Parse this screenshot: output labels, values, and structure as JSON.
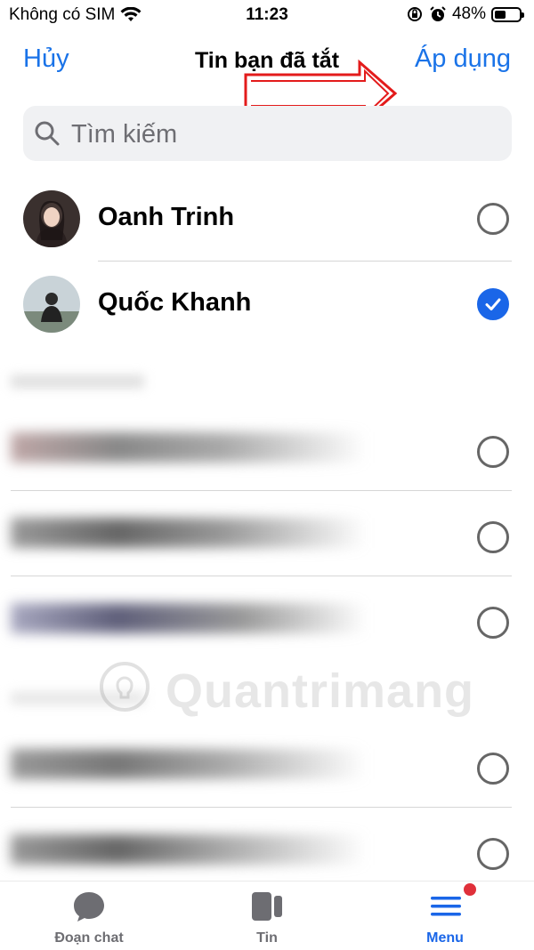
{
  "status_bar": {
    "carrier": "Không có SIM",
    "time": "11:23",
    "battery": "48%",
    "battery_level": 0.48
  },
  "nav": {
    "cancel": "Hủy",
    "title": "Tin bạn đã tắt",
    "apply": "Áp dụng"
  },
  "search": {
    "placeholder": "Tìm kiếm"
  },
  "contacts": [
    {
      "name": "Oanh Trinh",
      "selected": false
    },
    {
      "name": "Quốc Khanh",
      "selected": true
    }
  ],
  "watermark": "Quantrimang",
  "tabs": [
    {
      "label": "Đoạn chat",
      "icon": "chat-bubble-icon",
      "active": false
    },
    {
      "label": "Tin",
      "icon": "stories-icon",
      "active": false
    },
    {
      "label": "Menu",
      "icon": "menu-icon",
      "active": true,
      "badge": true
    }
  ],
  "colors": {
    "accent": "#1a66e8",
    "annotation_arrow": "#e31b1b",
    "badge": "#e0303a"
  }
}
